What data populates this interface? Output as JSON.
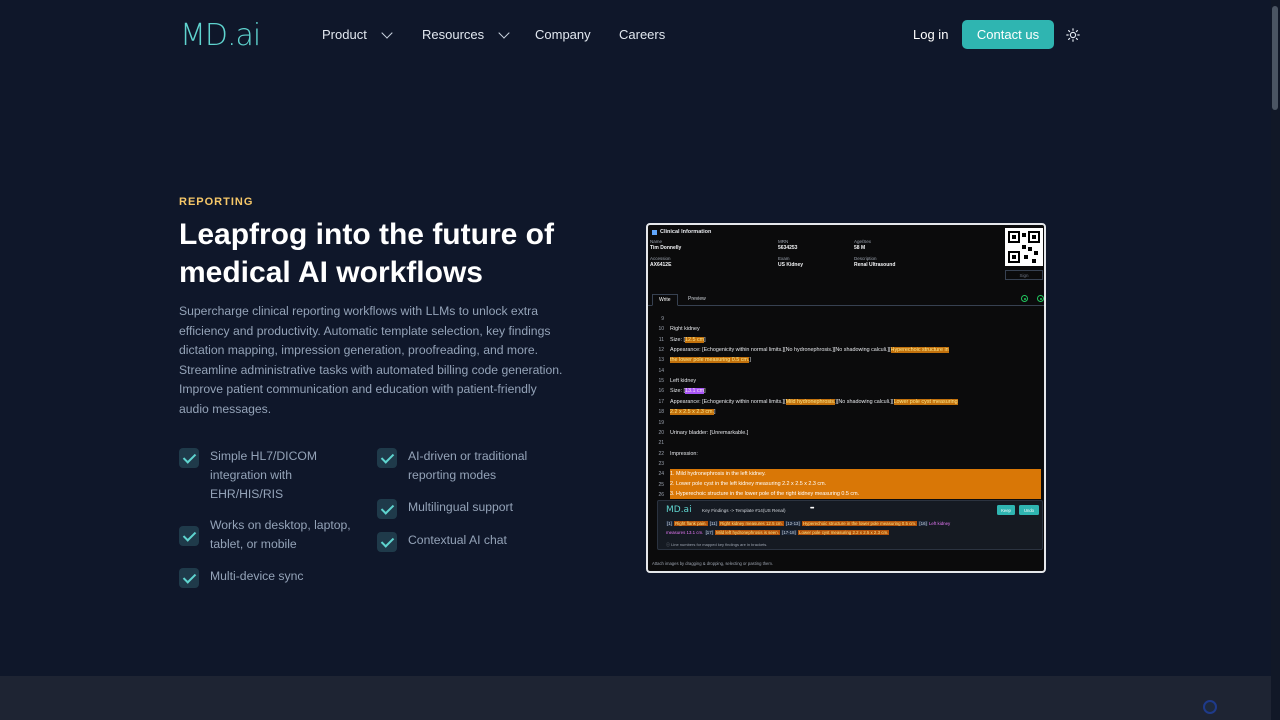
{
  "nav": {
    "logo_main": "MD",
    "logo_dot": ".",
    "logo_suffix": "ai",
    "items": [
      {
        "label": "Product"
      },
      {
        "label": "Resources"
      },
      {
        "label": "Company"
      },
      {
        "label": "Careers"
      }
    ],
    "login": "Log in",
    "contact": "Contact us"
  },
  "hero": {
    "eyebrow": "REPORTING",
    "title": "Leapfrog into the future of medical AI workflows",
    "description": "Supercharge clinical reporting workflows with LLMs to unlock extra efficiency and productivity. Automatic template selection, key findings dictation mapping, impression generation, proofreading, and more. Streamline administrative tasks with automated billing code generation. Improve patient communication and education with patient-friendly audio messages.",
    "features": [
      "Simple HL7/DICOM integration with EHR/HIS/RIS",
      "AI-driven or traditional reporting modes",
      "Works on desktop, laptop, tablet, or mobile",
      "Multilingual support",
      "Contextual AI chat",
      "Multi-device sync"
    ]
  },
  "panel": {
    "header": "Clinical Information",
    "fields": {
      "name_label": "Name",
      "name": "Tim Donnelly",
      "mrn_label": "MRN",
      "mrn": "5634253",
      "agesex_label": "Age/Sex",
      "agesex": "58 M",
      "accession_label": "Accession",
      "accession": "AX6412E",
      "exam_label": "Exam",
      "exam": "US Kidney",
      "description_label": "Description",
      "description": "Renal Ultrasound"
    },
    "sign": "Sign",
    "tabs": [
      "Write",
      "Preview"
    ],
    "lines": {
      "n9": "9",
      "n10": "10",
      "n11": "11",
      "n12": "12",
      "n13": "13",
      "n14": "14",
      "n15": "15",
      "n16": "16",
      "n17": "17",
      "n18": "18",
      "n19": "19",
      "n20": "20",
      "n21": "21",
      "n22": "22",
      "n23": "23",
      "n24": "24",
      "n25": "25",
      "n26": "26",
      "right_kidney": "Right kidney",
      "size_label": "Size: [",
      "size_r": "12.5 cm",
      "close": "]",
      "app_label": "Appearance: [",
      "app_r1": "Echogenicity within normal limits.][No hydronephrosis.][No shadowing calculi.][",
      "app_r_hl": "Hyperechoic structure in",
      "app_r_hl2": "the lower pole measuring 0.5 cm.",
      "left_kidney": "Left kidney",
      "size_l": "13.1 cm",
      "app_l1": "Echogenicity within normal limits.][",
      "app_l_hl": "Mild hydronephrosis.",
      "app_l2": "][No shadowing calculi.][",
      "app_l_hl2": "Lower pole cyst measuring",
      "app_l_hl3": "2.2 x 2.5 x 2.3 cm.",
      "bladder": "Urinary bladder: [Unremarkable.]",
      "impression": "Impression:",
      "imp1": "1. Mild hydronephrosis in the left kidney.",
      "imp2": "2. Lower pole cyst in the left kidney measuring 2.2 x 2.5 x 2.3 cm.",
      "imp3": "3. Hyperechoic structure in the lower pole of the right kidney measuring 0.5 cm."
    },
    "kf": {
      "logo": "MD.ai",
      "title": "Key Findings -> Template #14(US Renal)",
      "dots": "•••",
      "keep": "Keep",
      "undo": "Undo",
      "r1a": "[1]",
      "r1b": "Right flank pain.",
      "r1c": "[11]",
      "r1d": "Right kidney measures 12.5 cm.",
      "r1e": "[12-13]",
      "r1f": "Hyperechoic structure in the lower pole measuring 0.5 cm.",
      "r1g": "[16]",
      "r1h": "Left kidney",
      "r2a": "measures 13.1 cm.",
      "r2b": "[17]",
      "r2c": "Mild left hydronephrosis is seen.",
      "r2d": "[17-18]",
      "r2e": "Lower pole cyst measuring 2.2 x 2.5 x 2.3 cm.",
      "note": "Line numbers for mapped key findings are in brackets."
    },
    "attach": "Attach images by dragging & dropping, selecting or pasting them."
  }
}
